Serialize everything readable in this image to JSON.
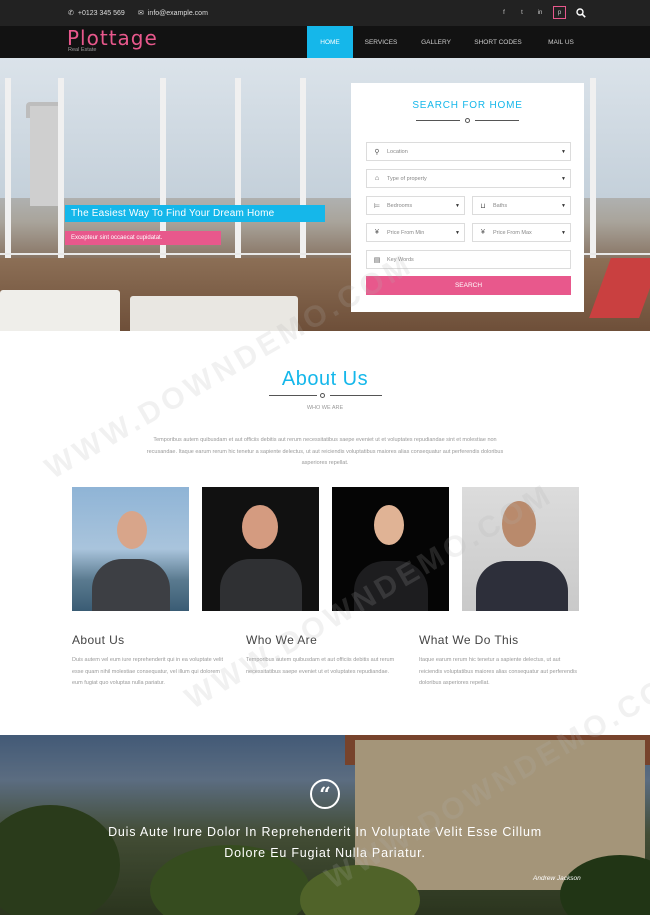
{
  "topbar": {
    "phone": "+0123 345 569",
    "email": "info@example.com",
    "social_icons": [
      "facebook-icon",
      "twitter-icon",
      "linkedin-icon",
      "pinterest-icon"
    ]
  },
  "brand": {
    "name": "Plottage",
    "tagline": "Real Estate"
  },
  "nav": [
    "HOME",
    "SERVICES",
    "GALLERY",
    "SHORT CODES",
    "MAIL US"
  ],
  "hero": {
    "title": "The Easiest Way To Find Your Dream Home",
    "subtitle": "Excepteur sint occaecat cupidatat."
  },
  "search": {
    "title": "SEARCH FOR HOME",
    "location": "Location",
    "type": "Type of property",
    "bedrooms": "Bedrooms",
    "baths": "Baths",
    "price_min": "Price From Min",
    "price_max": "Price From Max",
    "keywords": "Key Words",
    "button": "SEARCH"
  },
  "about": {
    "title": "About Us",
    "subtitle": "WHO WE ARE",
    "text": "Temporibus autem quibusdam et aut officiis debitis aut rerum necessitatibus saepe eveniet ut et voluptates repudiandae sint et molestiae non recusandae. Itaque earum rerum hic tenetur a sapiente delectus, ut aut reiciendis voluptatibus maiores alias consequatur aut perferendis doloribus asperiores repellat.",
    "columns": [
      {
        "title": "About Us",
        "text": "Duis autem vel eum iure reprehenderit qui in ea voluptate velit esse quam nihil molestiae consequatur, vel illum qui dolorem eum fugiat quo voluptas nulla pariatur."
      },
      {
        "title": "Who We Are",
        "text": "Temporibus autem quibusdam et aut officiis debitis aut rerum necessitatibus saepe eveniet ut et voluptates repudiandae."
      },
      {
        "title": "What We Do This",
        "text": "Itaque earum rerum hic tenetur a sapiente delectus, ut aut reiciendis voluptatibus maiores alias consequatur aut perferendis doloribus asperiores repellat."
      }
    ]
  },
  "testimonial": {
    "quote": "Duis Aute Irure Dolor In Reprehenderit In Voluptate Velit Esse Cillum Dolore Eu Fugiat Nulla Pariatur.",
    "author": "Andrew Jackson"
  },
  "watermark": "WWW.DOWNDEMO.COM",
  "colors": {
    "accent_blue": "#15b7ea",
    "accent_pink": "#e8588c",
    "topbar": "#222222",
    "navbar": "#121212"
  }
}
